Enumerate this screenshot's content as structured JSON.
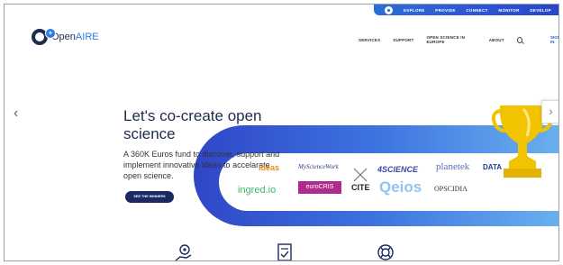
{
  "portal": {
    "links": [
      "EXPLORE",
      "PROVIDE",
      "CONNECT",
      "MONITOR",
      "DEVELOP"
    ]
  },
  "header": {
    "logo_text_1": "Open",
    "logo_text_2": "AIRE",
    "nav": [
      "SERVICES",
      "SUPPORT",
      "OPEN SCIENCE IN EUROPE",
      "ABOUT"
    ],
    "signin": "SIGN IN"
  },
  "hero": {
    "title": "Let's co-create open science",
    "text": "A 360K Euros fund to discover, support and implement innovative ideas to accelarate open science.",
    "button": "SEE THE WINNERS"
  },
  "partners": {
    "p1": "ideas",
    "p2": "MyScienceWork",
    "p3": "4SCIENCE",
    "p4": "planetek",
    "p5": "DATA",
    "p6": "ingred.io",
    "p7": "euroCRIS",
    "p8": "CITE",
    "p9": "Qeios",
    "p10": "OPSCIDIA"
  },
  "colors": {
    "accent": "#2c7be5",
    "navy": "#1b2864",
    "trophy": "#f2c400"
  },
  "icons": [
    "chevron-left-icon",
    "chevron-right-icon",
    "search-icon",
    "hand-gear-icon",
    "document-check-icon",
    "lifebuoy-icon"
  ]
}
